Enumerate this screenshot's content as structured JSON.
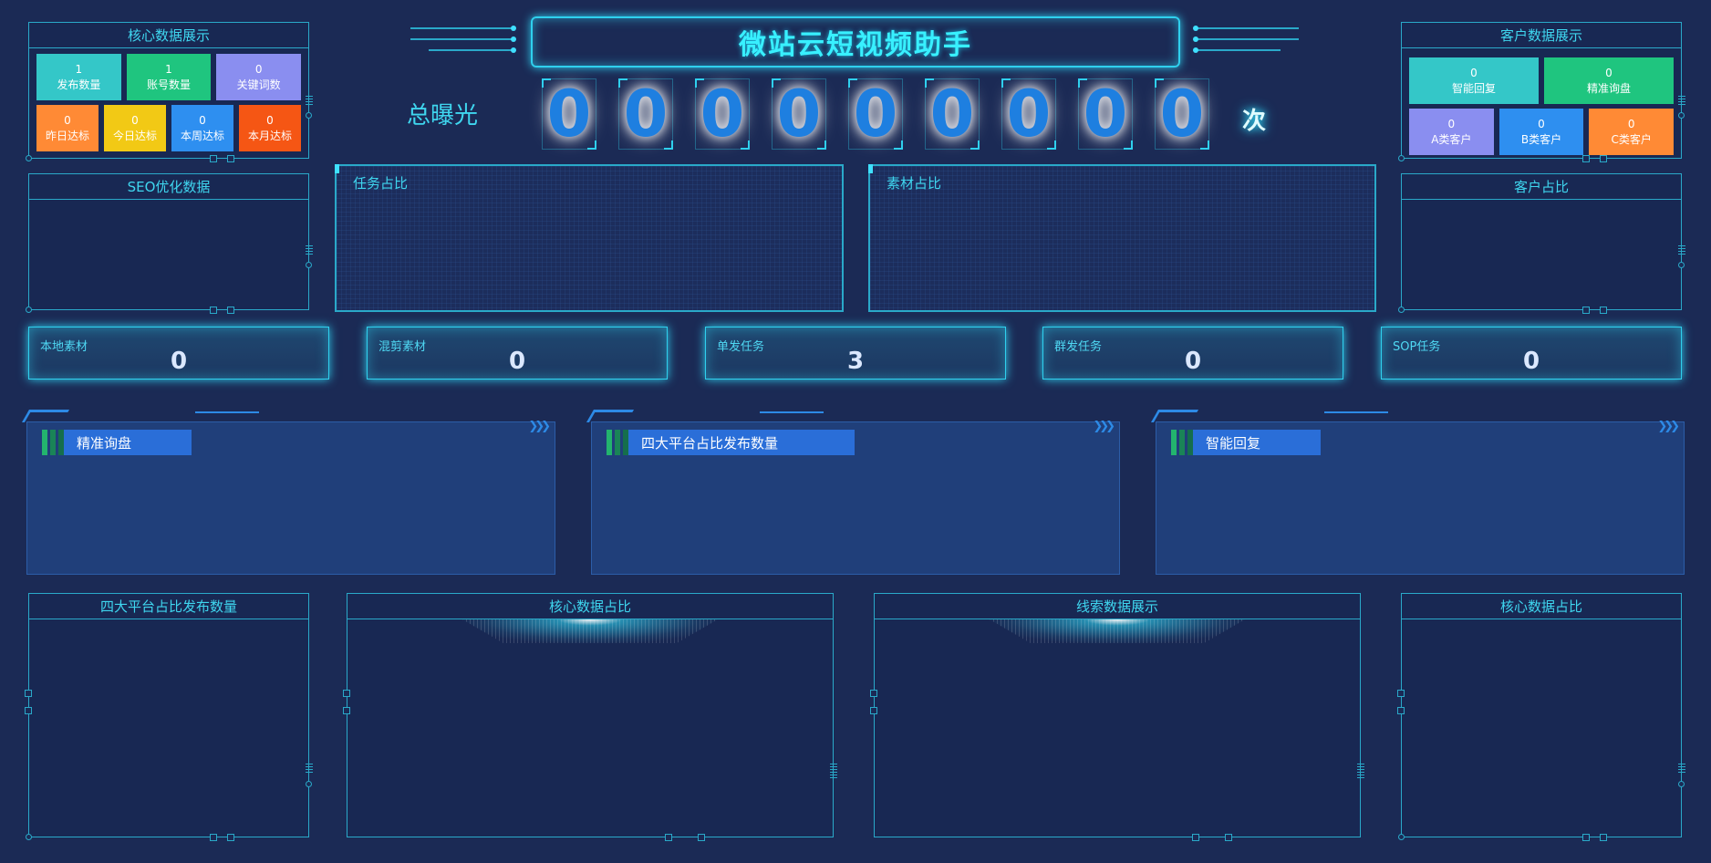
{
  "header": {
    "title": "微站云短视频助手",
    "exposure_label": "总曝光",
    "exposure_digits": [
      "0",
      "0",
      "0",
      "0",
      "0",
      "0",
      "0",
      "0",
      "0"
    ],
    "exposure_unit": "次"
  },
  "core_data": {
    "title": "核心数据展示",
    "tiles": [
      {
        "value": "1",
        "label": "发布数量",
        "color": "#34c7c8"
      },
      {
        "value": "1",
        "label": "账号数量",
        "color": "#1fc57f"
      },
      {
        "value": "0",
        "label": "关键词数",
        "color": "#8a8ef0"
      },
      {
        "value": "0",
        "label": "昨日达标",
        "color": "#ff8a35"
      },
      {
        "value": "0",
        "label": "今日达标",
        "color": "#f2c915"
      },
      {
        "value": "0",
        "label": "本周达标",
        "color": "#2e8ff0"
      },
      {
        "value": "0",
        "label": "本月达标",
        "color": "#f55614"
      }
    ]
  },
  "customer_data": {
    "title": "客户数据展示",
    "top_tiles": [
      {
        "value": "0",
        "label": "智能回复",
        "color": "#34c7c8"
      },
      {
        "value": "0",
        "label": "精准询盘",
        "color": "#1fc57f"
      }
    ],
    "bottom_tiles": [
      {
        "value": "0",
        "label": "A类客户",
        "color": "#8a8ef0"
      },
      {
        "value": "0",
        "label": "B类客户",
        "color": "#2e8ff0"
      },
      {
        "value": "0",
        "label": "C类客户",
        "color": "#ff8a35"
      }
    ]
  },
  "seo_panel": {
    "title": "SEO优化数据"
  },
  "customer_ratio_panel": {
    "title": "客户占比"
  },
  "task_ratio_panel": {
    "title": "任务占比"
  },
  "material_ratio_panel": {
    "title": "素材占比"
  },
  "metrics": [
    {
      "label": "本地素材",
      "value": "0"
    },
    {
      "label": "混剪素材",
      "value": "0"
    },
    {
      "label": "单发任务",
      "value": "3"
    },
    {
      "label": "群发任务",
      "value": "0"
    },
    {
      "label": "SOP任务",
      "value": "0"
    }
  ],
  "cards": [
    {
      "label": "精准询盘"
    },
    {
      "label": "四大平台占比发布数量"
    },
    {
      "label": "智能回复"
    }
  ],
  "bottom_panels": [
    {
      "title": "四大平台占比发布数量"
    },
    {
      "title": "核心数据占比"
    },
    {
      "title": "线索数据展示"
    },
    {
      "title": "核心数据占比"
    }
  ],
  "colors": {
    "background": "#1b2a55",
    "accent": "#2fd0ee",
    "title_text": "#38f0ff",
    "digit": "#1e7fe0"
  }
}
